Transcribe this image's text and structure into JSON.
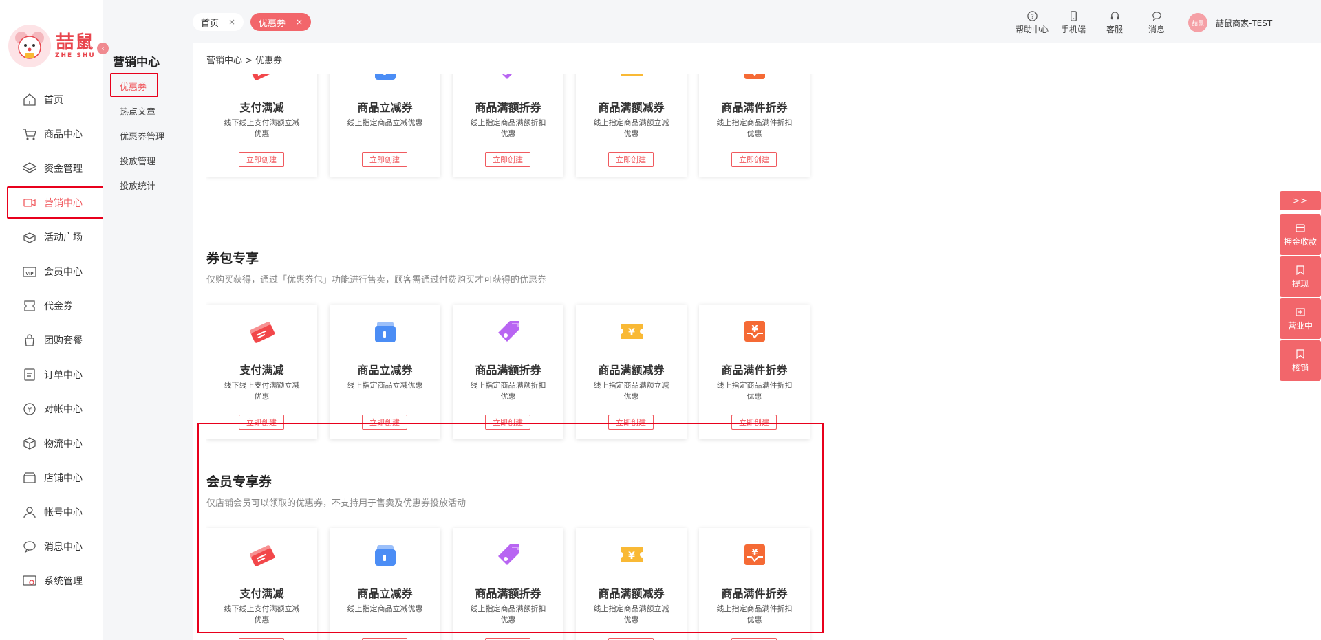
{
  "brand": {
    "name_cn": "喆鼠",
    "name_en": "ZHE SHU"
  },
  "sidebar": {
    "items": [
      {
        "label": "首页",
        "icon": "home-icon"
      },
      {
        "label": "商品中心",
        "icon": "cart-icon"
      },
      {
        "label": "资金管理",
        "icon": "layers-icon"
      },
      {
        "label": "营销中心",
        "icon": "marketing-icon",
        "active": true
      },
      {
        "label": "活动广场",
        "icon": "box-icon"
      },
      {
        "label": "会员中心",
        "icon": "vip-icon"
      },
      {
        "label": "代金券",
        "icon": "voucher-icon"
      },
      {
        "label": "团购套餐",
        "icon": "bag-icon"
      },
      {
        "label": "订单中心",
        "icon": "order-icon"
      },
      {
        "label": "对帐中心",
        "icon": "yen-icon"
      },
      {
        "label": "物流中心",
        "icon": "package-icon"
      },
      {
        "label": "店铺中心",
        "icon": "store-icon"
      },
      {
        "label": "帐号中心",
        "icon": "user-icon"
      },
      {
        "label": "消息中心",
        "icon": "message-icon"
      },
      {
        "label": "系统管理",
        "icon": "settings-icon"
      }
    ]
  },
  "submenu": {
    "title": "营销中心",
    "items": [
      {
        "label": "优惠券",
        "active": true
      },
      {
        "label": "热点文章"
      },
      {
        "label": "优惠券管理"
      },
      {
        "label": "投放管理"
      },
      {
        "label": "投放统计"
      }
    ]
  },
  "tabs": [
    {
      "label": "首页",
      "close": "×"
    },
    {
      "label": "优惠券",
      "close": "×"
    }
  ],
  "toolbar": {
    "help": "帮助中心",
    "mobile": "手机端",
    "service": "客服",
    "message": "消息",
    "user": "喆鼠商家-TEST",
    "avatar_text": "喆鼠"
  },
  "breadcrumb": "营销中心 > 优惠券",
  "cards": [
    {
      "title": "支付满减",
      "desc": "线下线上支付满额立减优惠",
      "button": "立即创建",
      "icon": "ticket-icon",
      "color": "#f2474a"
    },
    {
      "title": "商品立减券",
      "desc": "线上指定商品立减优惠",
      "button": "立即创建",
      "icon": "wallet-icon",
      "color": "#4b8df5"
    },
    {
      "title": "商品满额折券",
      "desc": "线上指定商品满额折扣优惠",
      "button": "立即创建",
      "icon": "tag-icon",
      "color": "#b865f2"
    },
    {
      "title": "商品满额减券",
      "desc": "线上指定商品满额立减优惠",
      "button": "立即创建",
      "icon": "yen-ticket-icon",
      "color": "#f9b935"
    },
    {
      "title": "商品满件折券",
      "desc": "线上指定商品满件折扣优惠",
      "button": "立即创建",
      "icon": "yen-box-icon",
      "color": "#f56a35"
    }
  ],
  "sections": [
    {
      "title": "券包专享",
      "desc": "仅购买获得，通过「优惠券包」功能进行售卖，顾客需通过付费购买才可获得的优惠券"
    },
    {
      "title": "会员专享券",
      "desc": "仅店铺会员可以领取的优惠券，不支持用于售卖及优惠券投放活动"
    }
  ],
  "right_panel": {
    "expand": ">>",
    "items": [
      {
        "label": "押金收款",
        "icon": "card-icon"
      },
      {
        "label": "提现",
        "icon": "bookmark-icon"
      },
      {
        "label": "营业中",
        "icon": "shop-icon"
      },
      {
        "label": "核销",
        "icon": "bookmark-icon"
      }
    ]
  }
}
